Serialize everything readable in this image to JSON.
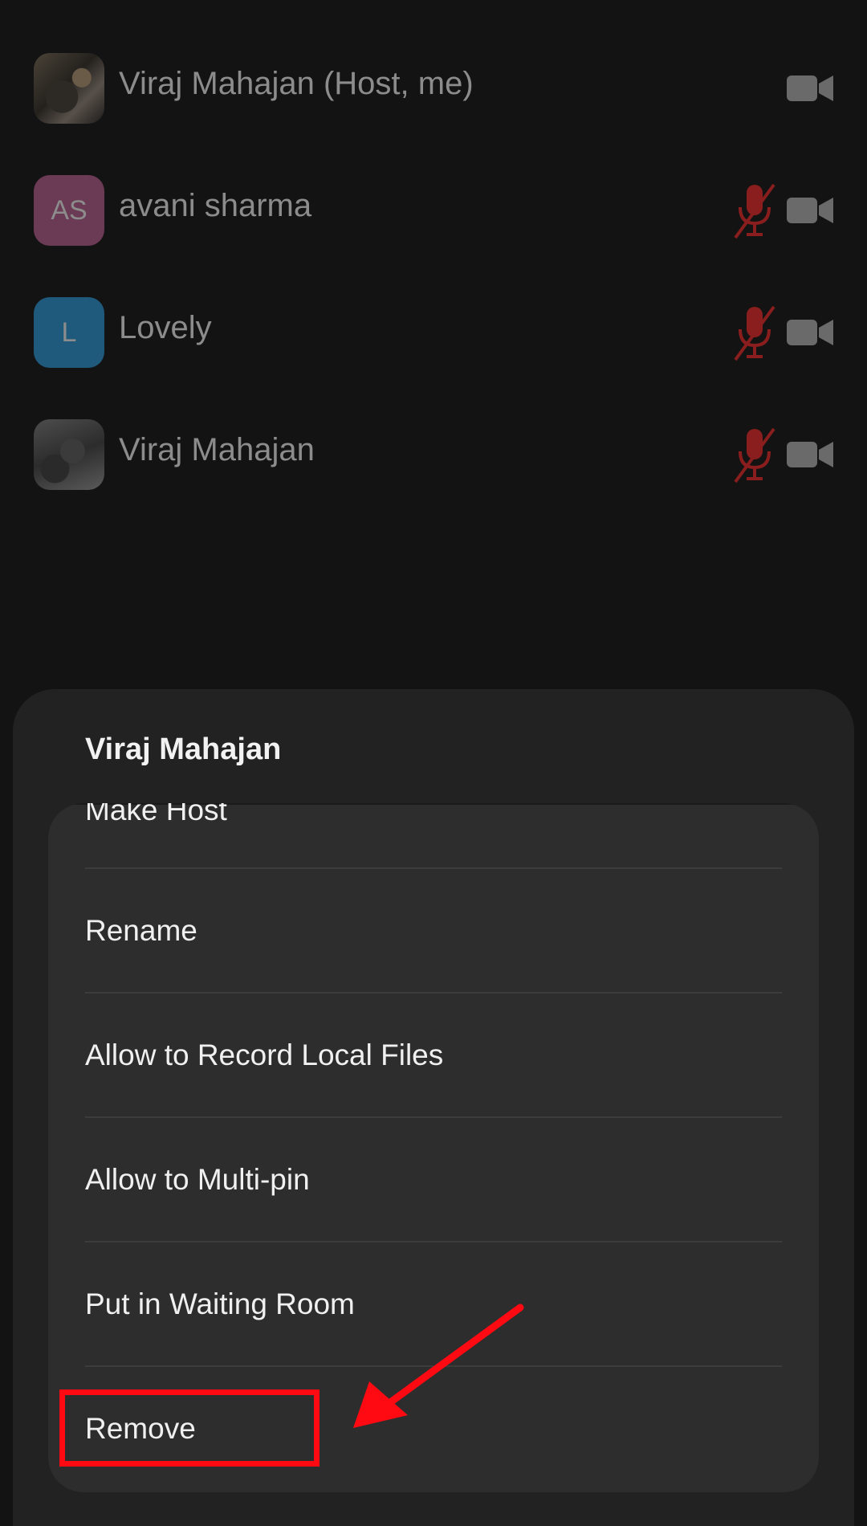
{
  "participants": [
    {
      "name": "Viraj Mahajan (Host, me)",
      "avatar": "photo",
      "initials": "",
      "muted": false,
      "icons": [
        "video-icon"
      ]
    },
    {
      "name": "avani sharma",
      "avatar": "initials",
      "initials": "AS",
      "muted": true,
      "icons": [
        "mic-muted-icon",
        "video-icon"
      ]
    },
    {
      "name": "Lovely",
      "avatar": "initials",
      "initials": "L",
      "muted": true,
      "icons": [
        "mic-muted-icon",
        "video-icon"
      ]
    },
    {
      "name": "Viraj Mahajan",
      "avatar": "photo",
      "initials": "",
      "muted": true,
      "icons": [
        "mic-muted-icon",
        "video-icon"
      ]
    }
  ],
  "sheet": {
    "title": "Viraj Mahajan",
    "items": [
      {
        "label": "Make Host"
      },
      {
        "label": "Rename"
      },
      {
        "label": "Allow to Record Local Files"
      },
      {
        "label": "Allow to Multi-pin"
      },
      {
        "label": "Put in Waiting Room"
      },
      {
        "label": "Remove"
      }
    ]
  },
  "annotation": {
    "highlighted_item": "Remove",
    "color": "#ff0a12"
  },
  "colors": {
    "background": "#131313",
    "sheet": "#222222",
    "card": "#2d2d2d",
    "muted_red": "#8a1d1d",
    "dim_text": "#8c8c8c"
  }
}
